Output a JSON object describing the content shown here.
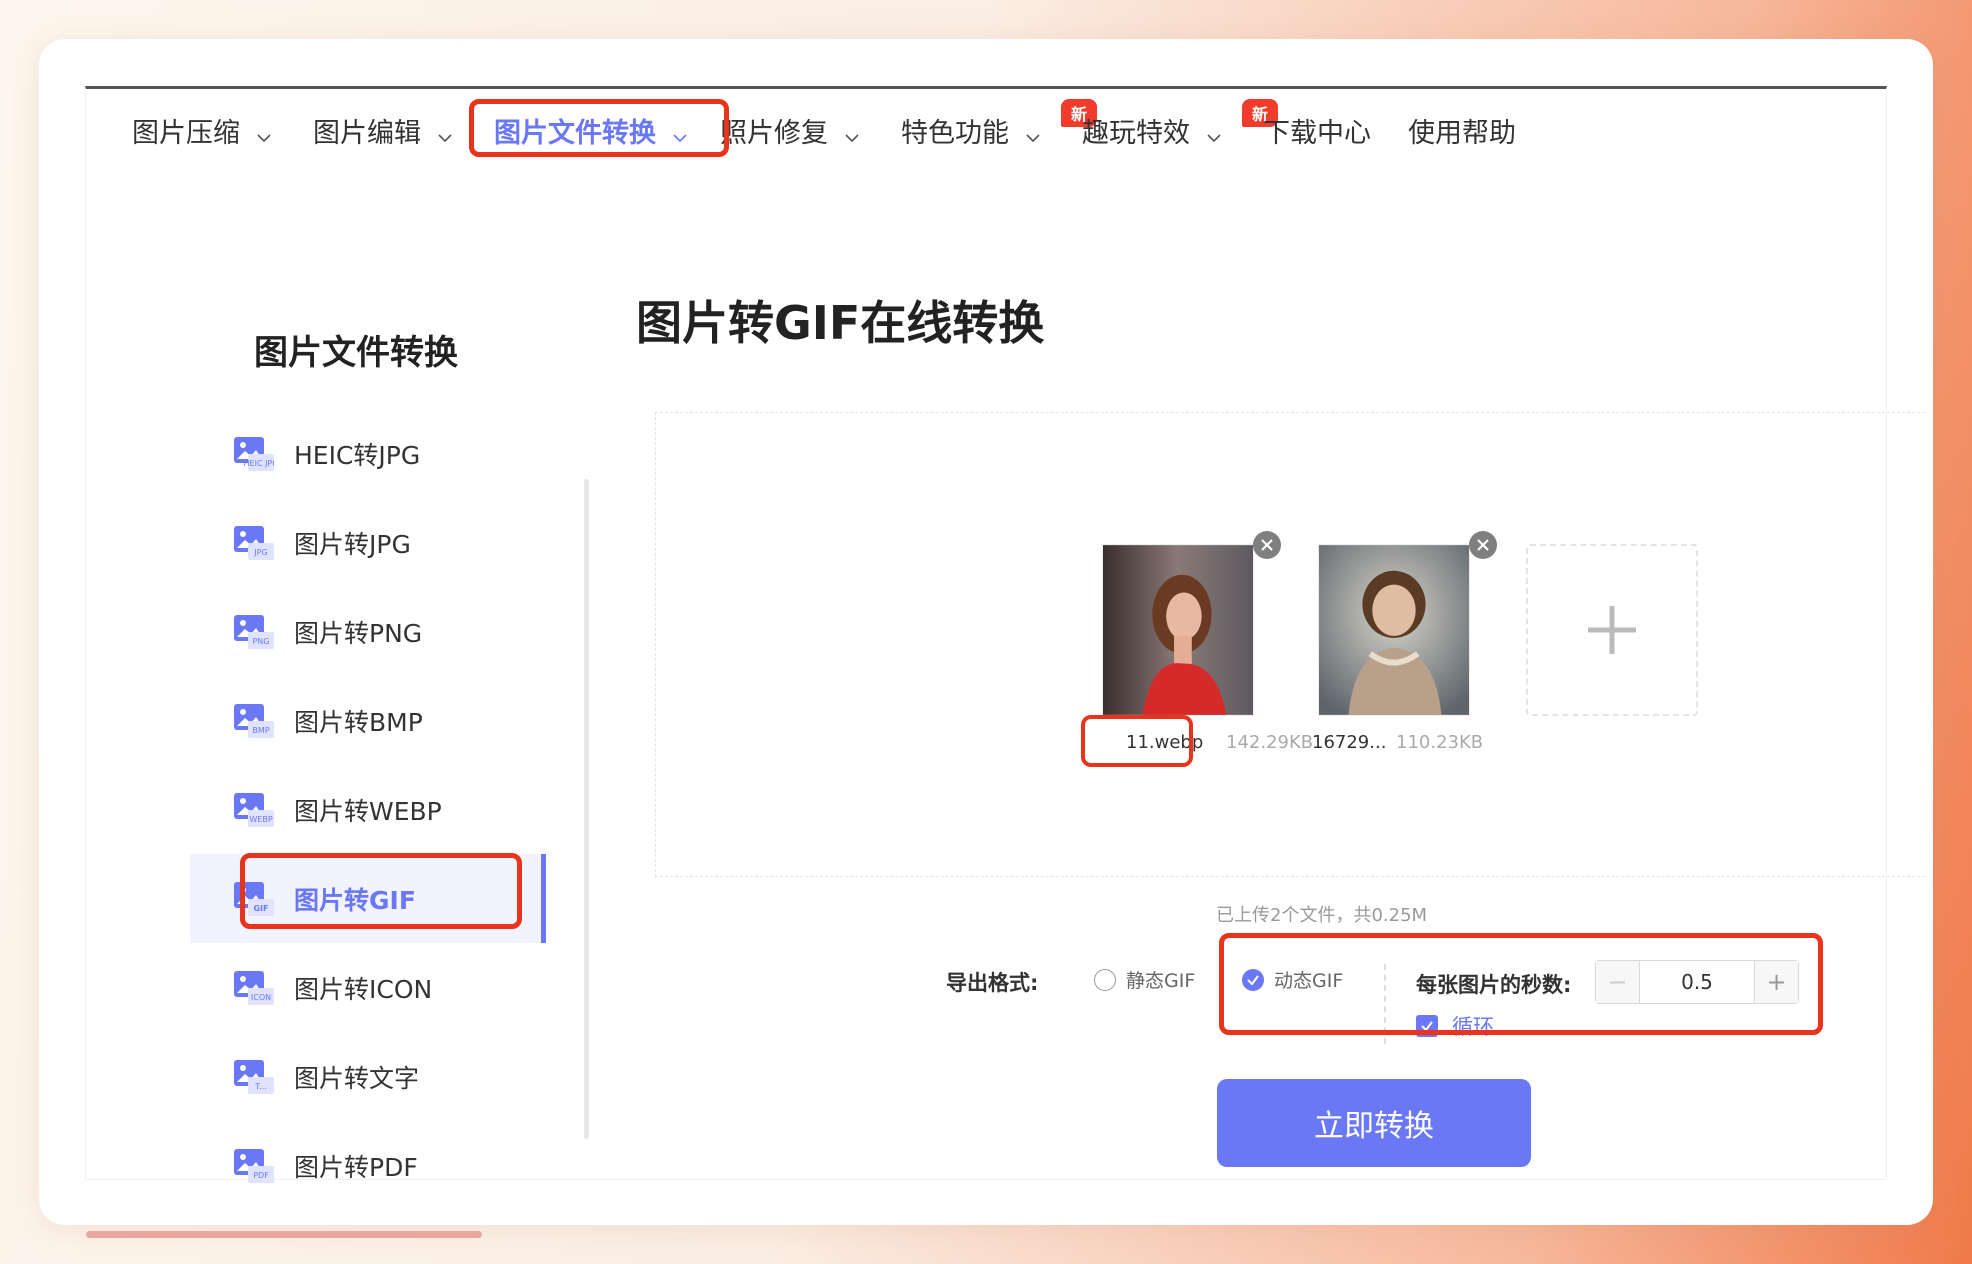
{
  "nav": {
    "items": [
      {
        "label": "图片压缩",
        "has_chevron": true
      },
      {
        "label": "图片编辑",
        "has_chevron": true
      },
      {
        "label": "图片文件转换",
        "has_chevron": true,
        "active": true
      },
      {
        "label": "照片修复",
        "has_chevron": true
      },
      {
        "label": "特色功能",
        "has_chevron": true,
        "badge": "新"
      },
      {
        "label": "趣玩特效",
        "has_chevron": true,
        "badge": "新"
      },
      {
        "label": "下载中心",
        "has_chevron": false
      },
      {
        "label": "使用帮助",
        "has_chevron": false
      }
    ]
  },
  "sidebar": {
    "title": "图片文件转换",
    "items": [
      {
        "label": "HEIC转JPG",
        "icon_tag": "HEIC JPG",
        "icon": "heic-jpg-icon"
      },
      {
        "label": "图片转JPG",
        "icon_tag": "JPG",
        "icon": "jpg-image-icon"
      },
      {
        "label": "图片转PNG",
        "icon_tag": "PNG",
        "icon": "png-image-icon"
      },
      {
        "label": "图片转BMP",
        "icon_tag": "BMP",
        "icon": "bmp-image-icon"
      },
      {
        "label": "图片转WEBP",
        "icon_tag": "WEBP",
        "icon": "webp-image-icon"
      },
      {
        "label": "图片转GIF",
        "icon_tag": "GIF",
        "icon": "gif-image-icon",
        "active": true
      },
      {
        "label": "图片转ICON",
        "icon_tag": "ICON",
        "icon": "icon-image-icon"
      },
      {
        "label": "图片转文字",
        "icon_tag": "T...",
        "icon": "text-image-icon"
      },
      {
        "label": "图片转PDF",
        "icon_tag": "PDF",
        "icon": "pdf-image-icon"
      }
    ]
  },
  "main": {
    "title": "图片转GIF在线转换",
    "files": [
      {
        "name": "11.webp",
        "size": "142.29KB"
      },
      {
        "name": "16729...",
        "size": "110.23KB"
      }
    ],
    "upload_summary": "已上传2个文件，共0.25M",
    "export_label": "导出格式:",
    "options": {
      "static_gif": "静态GIF",
      "animated_gif": "动态GIF",
      "selected": "animated_gif",
      "seconds_label": "每张图片的秒数:",
      "seconds_value": "0.5",
      "loop_label": "循环",
      "loop_checked": true
    },
    "convert_button": "立即转换"
  },
  "colors": {
    "accent": "#6a78f5",
    "highlight_box": "#e8341c",
    "badge": "#f13c2c"
  }
}
